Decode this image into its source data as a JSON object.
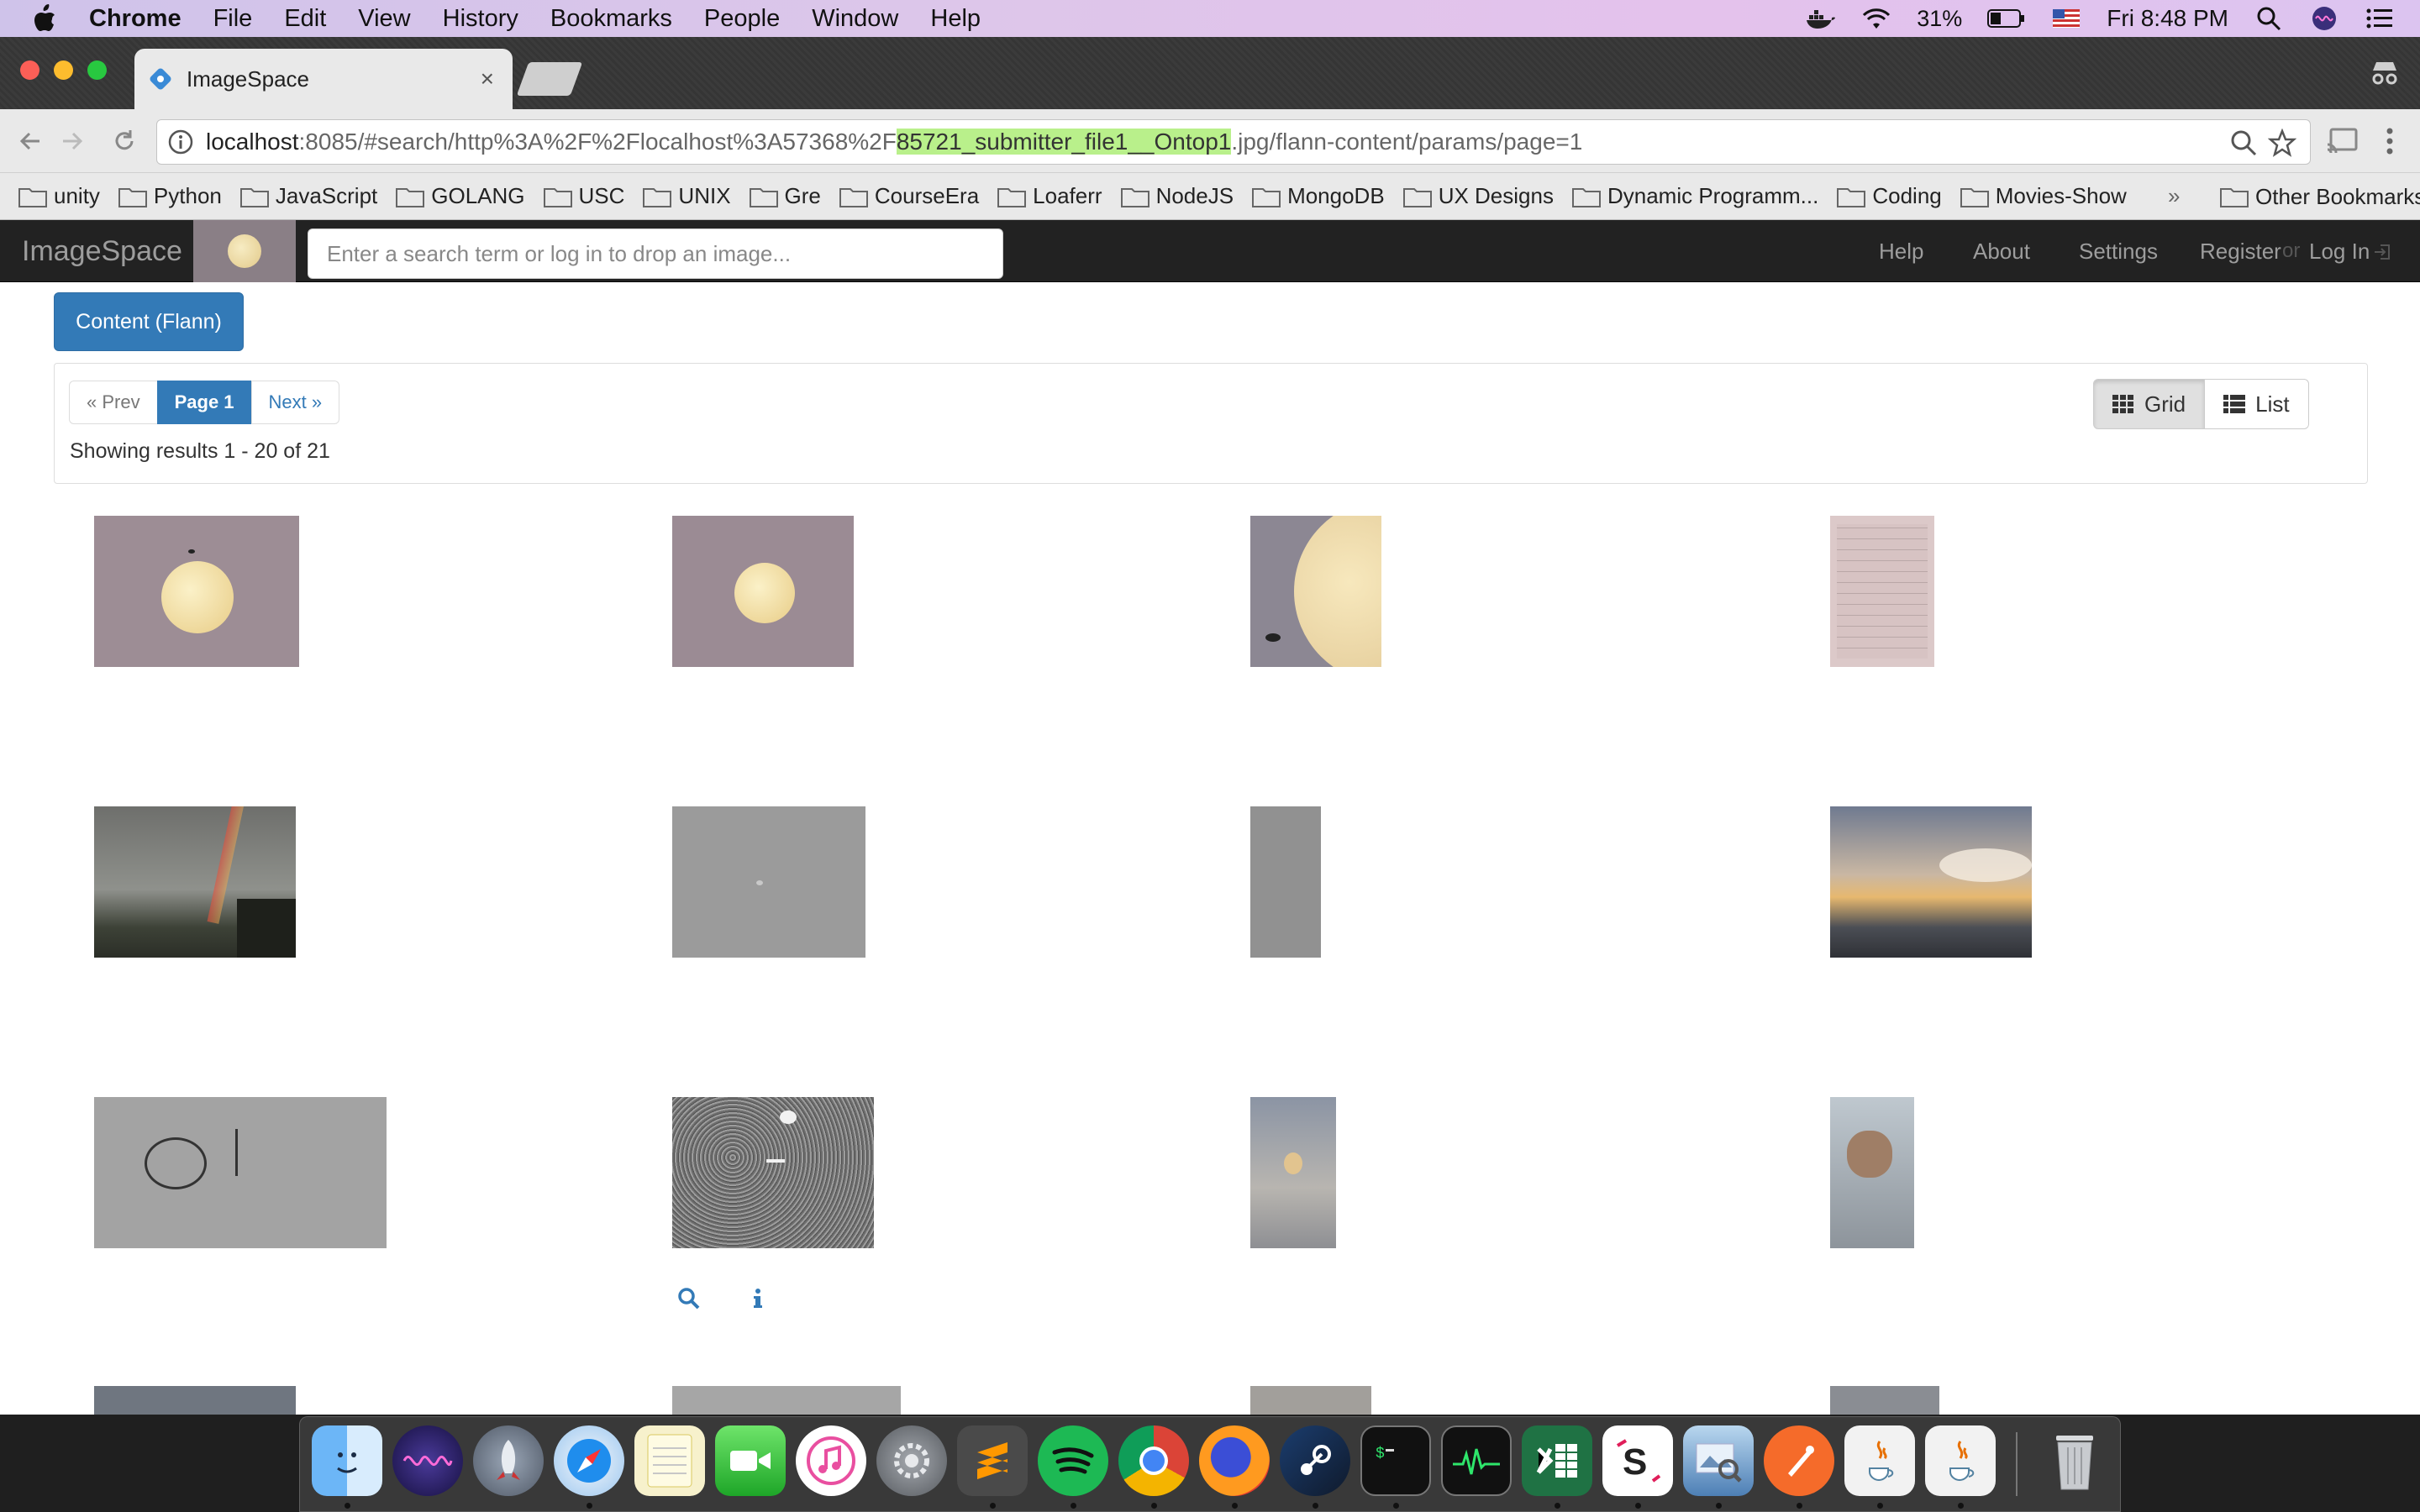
{
  "menubar": {
    "app": "Chrome",
    "items": [
      "File",
      "Edit",
      "View",
      "History",
      "Bookmarks",
      "People",
      "Window",
      "Help"
    ],
    "battery": "31%",
    "clock": "Fri 8:48 PM"
  },
  "tab": {
    "title": "ImageSpace",
    "close": "×"
  },
  "omnibox": {
    "host": "localhost",
    "path_before": ":8085/#search/http%3A%2F%2Flocalhost%3A57368%2F",
    "highlight": "85721_submitter_file1__Ontop1",
    "path_after": ".jpg/flann-content/params/page=1"
  },
  "bookmarks": {
    "items": [
      "unity",
      "Python",
      "JavaScript",
      "GOLANG",
      "USC",
      "UNIX",
      "Gre",
      "CourseEra",
      "Loaferr",
      "NodeJS",
      "MongoDB",
      "UX Designs",
      "Dynamic Programm...",
      "Coding",
      "Movies-Show"
    ],
    "more": "»",
    "other": "Other Bookmarks"
  },
  "navbar": {
    "brand": "ImageSpace",
    "search_placeholder": "Enter a search term or log in to drop an image...",
    "help": "Help",
    "about": "About",
    "settings": "Settings",
    "register": "Register",
    "or": "or",
    "login": "Log In"
  },
  "content_button": "Content (Flann)",
  "pagination": {
    "prev": "« Prev",
    "current": "Page 1",
    "next": "Next »"
  },
  "results_text": "Showing results 1 - 20 of 21",
  "view_toggle": {
    "grid": "Grid",
    "list": "List",
    "selected": "grid"
  },
  "colors": {
    "brand_blue": "#337ab7",
    "navbar_bg": "#222222",
    "url_highlight": "#b9f08b"
  },
  "thumbnails": [
    {
      "subject": "full moon on mauve sky"
    },
    {
      "subject": "full moon on mauve sky"
    },
    {
      "subject": "close-up large moon"
    },
    {
      "subject": "scanned paper document"
    },
    {
      "subject": "rainbow over houses"
    },
    {
      "subject": "grey textured surface"
    },
    {
      "subject": "narrow grey image"
    },
    {
      "subject": "sunset clouds landscape"
    },
    {
      "subject": "grey surface with drawn circle"
    },
    {
      "subject": "noisy grey speckle"
    },
    {
      "subject": "moon behind clouds"
    },
    {
      "subject": "rocky object on screen"
    },
    {
      "subject": "partial thumbnail"
    },
    {
      "subject": "partial thumbnail"
    },
    {
      "subject": "partial thumbnail"
    },
    {
      "subject": "partial thumbnail"
    }
  ],
  "hover_tools": [
    "search-icon",
    "info-icon"
  ],
  "dock": {
    "apps": [
      "Finder",
      "Siri",
      "Launchpad",
      "Safari",
      "Notes",
      "FaceTime",
      "iTunes",
      "System Preferences",
      "Sublime Text",
      "Spotify",
      "Chrome",
      "Firefox",
      "Steam",
      "Terminal",
      "Activity Monitor",
      "Excel",
      "Slack",
      "Preview",
      "Postman",
      "Java",
      "Java",
      "Trash"
    ]
  }
}
